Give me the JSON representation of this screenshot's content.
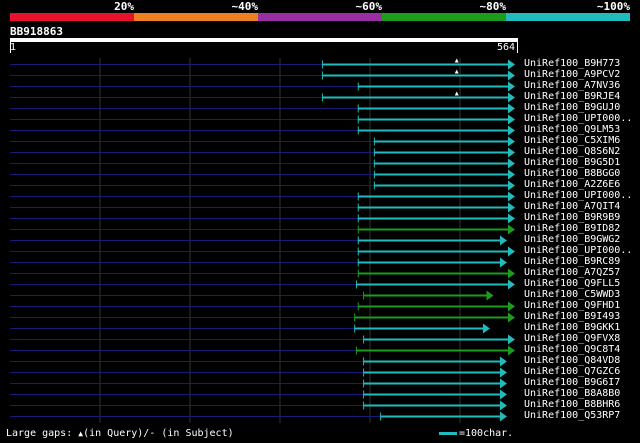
{
  "legend": {
    "labels": [
      "20%",
      "~40%",
      "~60%",
      "~80%",
      "~100%"
    ],
    "colors": [
      "#e8132b",
      "#ee8022",
      "#9a2fa3",
      "#1d9b1d",
      "#22bbbb"
    ]
  },
  "query": {
    "id": "BB918863",
    "start": "1",
    "end": "564",
    "length": 564
  },
  "hits": [
    {
      "name": "UniRef100_B9H773",
      "start": 350,
      "end": 564,
      "color": "cyan",
      "gap_mark": 500
    },
    {
      "name": "UniRef100_A9PCV2",
      "start": 350,
      "end": 564,
      "color": "cyan",
      "gap_mark": 500
    },
    {
      "name": "UniRef100_A7NV36",
      "start": 390,
      "end": 564,
      "color": "cyan"
    },
    {
      "name": "UniRef100_B9RJE4",
      "start": 350,
      "end": 564,
      "color": "cyan",
      "gap_mark": 500
    },
    {
      "name": "UniRef100_B9GUJ0",
      "start": 390,
      "end": 564,
      "color": "cyan"
    },
    {
      "name": "UniRef100_UPI000..",
      "start": 390,
      "end": 564,
      "color": "cyan"
    },
    {
      "name": "UniRef100_Q9LM53",
      "start": 390,
      "end": 564,
      "color": "cyan"
    },
    {
      "name": "UniRef100_C5XIM6",
      "start": 408,
      "end": 564,
      "color": "cyan"
    },
    {
      "name": "UniRef100_Q8S6N2",
      "start": 408,
      "end": 564,
      "color": "cyan"
    },
    {
      "name": "UniRef100_B9G5D1",
      "start": 408,
      "end": 564,
      "color": "cyan"
    },
    {
      "name": "UniRef100_B8BGG0",
      "start": 408,
      "end": 564,
      "color": "cyan"
    },
    {
      "name": "UniRef100_A2Z6E6",
      "start": 408,
      "end": 564,
      "color": "cyan"
    },
    {
      "name": "UniRef100_UPI000..",
      "start": 390,
      "end": 564,
      "color": "cyan"
    },
    {
      "name": "UniRef100_A7QIT4",
      "start": 390,
      "end": 564,
      "color": "cyan"
    },
    {
      "name": "UniRef100_B9R9B9",
      "start": 390,
      "end": 564,
      "color": "cyan"
    },
    {
      "name": "UniRef100_B9ID82",
      "start": 390,
      "end": 564,
      "color": "green"
    },
    {
      "name": "UniRef100_B9GWG2",
      "start": 390,
      "end": 555,
      "color": "cyan"
    },
    {
      "name": "UniRef100_UPI000..",
      "start": 390,
      "end": 564,
      "color": "cyan"
    },
    {
      "name": "UniRef100_B9RC89",
      "start": 390,
      "end": 555,
      "color": "cyan"
    },
    {
      "name": "UniRef100_A7QZ57",
      "start": 390,
      "end": 564,
      "color": "green"
    },
    {
      "name": "UniRef100_Q9FLL5",
      "start": 388,
      "end": 564,
      "color": "cyan"
    },
    {
      "name": "UniRef100_C5WWD3",
      "start": 396,
      "end": 540,
      "color": "green"
    },
    {
      "name": "UniRef100_Q9FHD1",
      "start": 390,
      "end": 564,
      "color": "green"
    },
    {
      "name": "UniRef100_B9I493",
      "start": 386,
      "end": 564,
      "color": "green"
    },
    {
      "name": "UniRef100_B9GKK1",
      "start": 386,
      "end": 536,
      "color": "cyan"
    },
    {
      "name": "UniRef100_Q9FVX8",
      "start": 396,
      "end": 564,
      "color": "cyan"
    },
    {
      "name": "UniRef100_Q9C8T4",
      "start": 388,
      "end": 564,
      "color": "green"
    },
    {
      "name": "UniRef100_Q84VD8",
      "start": 396,
      "end": 555,
      "color": "cyan"
    },
    {
      "name": "UniRef100_Q7GZC6",
      "start": 396,
      "end": 555,
      "color": "cyan"
    },
    {
      "name": "UniRef100_B9G6I7",
      "start": 396,
      "end": 555,
      "color": "cyan"
    },
    {
      "name": "UniRef100_B8A8B0",
      "start": 396,
      "end": 555,
      "color": "cyan"
    },
    {
      "name": "UniRef100_B8BHR6",
      "start": 396,
      "end": 555,
      "color": "cyan"
    },
    {
      "name": "UniRef100_Q53RP7",
      "start": 415,
      "end": 555,
      "color": "cyan"
    }
  ],
  "footer": {
    "gaps_prefix": "Large gaps:",
    "query_gap_glyph": "▲",
    "gaps_text": "(in Query)/- (in Subject)",
    "scale_text": "=100char."
  },
  "colors": {
    "cyan": "#22bbbb",
    "green": "#1d9b1d",
    "track": "#1a1a78",
    "grid": "#333333"
  }
}
